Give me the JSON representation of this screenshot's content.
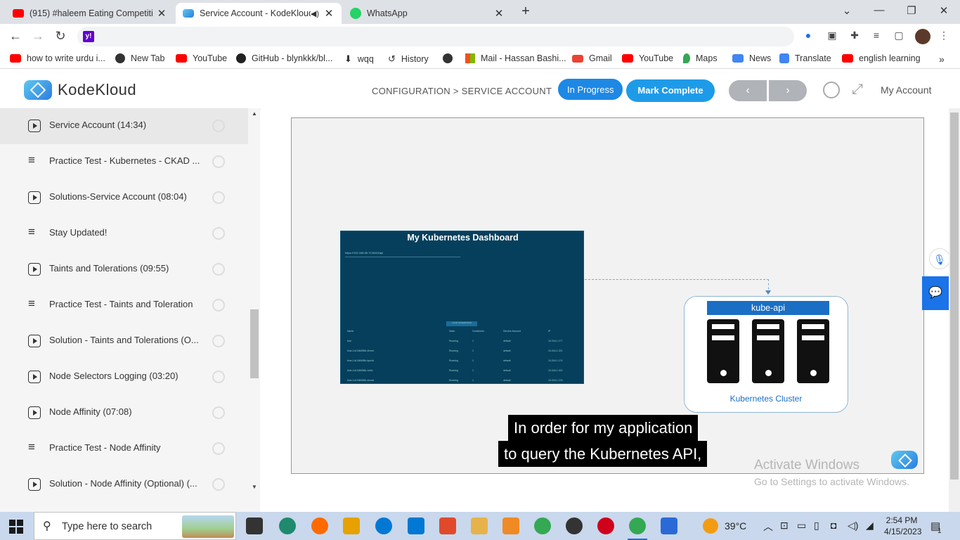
{
  "tabs": [
    {
      "title": "(915) #haleem Eating Competiti",
      "active": false,
      "icon": "youtube-icon"
    },
    {
      "title": "Service Account - KodeKloud",
      "active": true,
      "icon": "kodekloud-icon"
    },
    {
      "title": "WhatsApp",
      "active": false,
      "icon": "whatsapp-icon"
    }
  ],
  "omnibox": {
    "value": ""
  },
  "bookmarks": [
    {
      "label": "how to write urdu i...",
      "icon": "youtube-icon",
      "color": "#ff0000"
    },
    {
      "label": "New Tab",
      "icon": "globe-icon",
      "color": "#333333"
    },
    {
      "label": "YouTube",
      "icon": "youtube-icon",
      "color": "#ff0000"
    },
    {
      "label": "GitHub - blynkkk/bl...",
      "icon": "github-icon",
      "color": "#222222"
    },
    {
      "label": "wqq",
      "icon": "download-icon",
      "color": "#333333"
    },
    {
      "label": "History",
      "icon": "history-icon",
      "color": "#333333"
    },
    {
      "label": "",
      "icon": "globe-icon",
      "color": "#333333"
    },
    {
      "label": "Mail - Hassan Bashi...",
      "icon": "microsoft-icon",
      "color": "#f25022"
    },
    {
      "label": "Gmail",
      "icon": "gmail-icon",
      "color": "#ea4335"
    },
    {
      "label": "YouTube",
      "icon": "youtube-icon",
      "color": "#ff0000"
    },
    {
      "label": "Maps",
      "icon": "maps-icon",
      "color": "#34a853"
    },
    {
      "label": "News",
      "icon": "news-icon",
      "color": "#4285f4"
    },
    {
      "label": "Translate",
      "icon": "translate-icon",
      "color": "#4285f4"
    },
    {
      "label": "english learning",
      "icon": "youtube-icon",
      "color": "#ff0000"
    }
  ],
  "header": {
    "logo_text": "KodeKloud",
    "breadcrumb": "CONFIGURATION > SERVICE ACCOUNT",
    "status_label": "In Progress",
    "complete_label": "Mark Complete",
    "prev_label": "‹",
    "next_label": "›",
    "account_label": "My Account"
  },
  "sidebar": {
    "items": [
      {
        "label": "Service Account (14:34)",
        "type": "video",
        "active": true
      },
      {
        "label": "Practice Test - Kubernetes - CKAD ...",
        "type": "lab",
        "active": false
      },
      {
        "label": "Solutions-Service Account (08:04)",
        "type": "video",
        "active": false
      },
      {
        "label": "Stay Updated!",
        "type": "lab",
        "active": false
      },
      {
        "label": "Taints and Tolerations (09:55)",
        "type": "video",
        "active": false
      },
      {
        "label": "Practice Test - Taints and Toleration",
        "type": "lab",
        "active": false
      },
      {
        "label": "Solution - Taints and Tolerations (O...",
        "type": "video",
        "active": false
      },
      {
        "label": "Node Selectors Logging (03:20)",
        "type": "video",
        "active": false
      },
      {
        "label": "Node Affinity (07:08)",
        "type": "video",
        "active": false
      },
      {
        "label": "Practice Test - Node Affinity",
        "type": "lab",
        "active": false
      },
      {
        "label": "Solution - Node Affinity (Optional) (...",
        "type": "video",
        "active": false
      }
    ]
  },
  "video": {
    "dashboard_title": "My Kubernetes Dashboard",
    "dashboard_url": "https://192.168.56.70:6443/api",
    "dashboard_button": "LOAD DASHBOARD",
    "dashboard_columns": [
      "Name",
      "State",
      "Containers",
      "Service Account",
      "IP"
    ],
    "dashboard_rows": [
      [
        "test",
        "Running",
        "1",
        "default",
        "10.244.1.177"
      ],
      [
        "blue-14c7d8498b-4fxmd",
        "Running",
        "1",
        "default",
        "10.244.1.221"
      ],
      [
        "blue-14c7d8498b-fqm4d",
        "Running",
        "1",
        "default",
        "10.244.1.174"
      ],
      [
        "blue-14c7d8498b-1mflc",
        "Running",
        "1",
        "default",
        "10.244.1.222"
      ],
      [
        "blue-14c7d8498b-4mwzl",
        "Running",
        "1",
        "default",
        "10.244.1.176"
      ]
    ],
    "api_label": "kube-api",
    "cluster_label": "Kubernetes Cluster",
    "caption_line1": "In order for my application",
    "caption_line2": "to query the Kubernetes API,"
  },
  "watermark": {
    "line1": "Activate Windows",
    "line2": "Go to Settings to activate Windows."
  },
  "taskbar": {
    "search_placeholder": "Type here to search",
    "temperature": "39°C",
    "time": "2:54 PM",
    "date": "4/15/2023",
    "notification_count": "1",
    "apps": [
      {
        "name": "task-view-icon",
        "color": "#333333"
      },
      {
        "name": "edge-icon",
        "color": "#1f8a6d"
      },
      {
        "name": "firefox-icon",
        "color": "#ff6a00"
      },
      {
        "name": "store-icon",
        "color": "#e7a100"
      },
      {
        "name": "skype-icon",
        "color": "#0078d4"
      },
      {
        "name": "mail-icon",
        "color": "#0078d4"
      },
      {
        "name": "app-icon",
        "color": "#e04a2b"
      },
      {
        "name": "file-explorer-icon",
        "color": "#e6b34a"
      },
      {
        "name": "gear-app-icon",
        "color": "#f08a24"
      },
      {
        "name": "chrome-icon",
        "color": "#34a853"
      },
      {
        "name": "obs-icon",
        "color": "#333333"
      },
      {
        "name": "opera-icon",
        "color": "#d0021b"
      },
      {
        "name": "chrome-profile-icon",
        "color": "#34a853"
      },
      {
        "name": "photos-icon",
        "color": "#2b6ad6"
      }
    ]
  }
}
